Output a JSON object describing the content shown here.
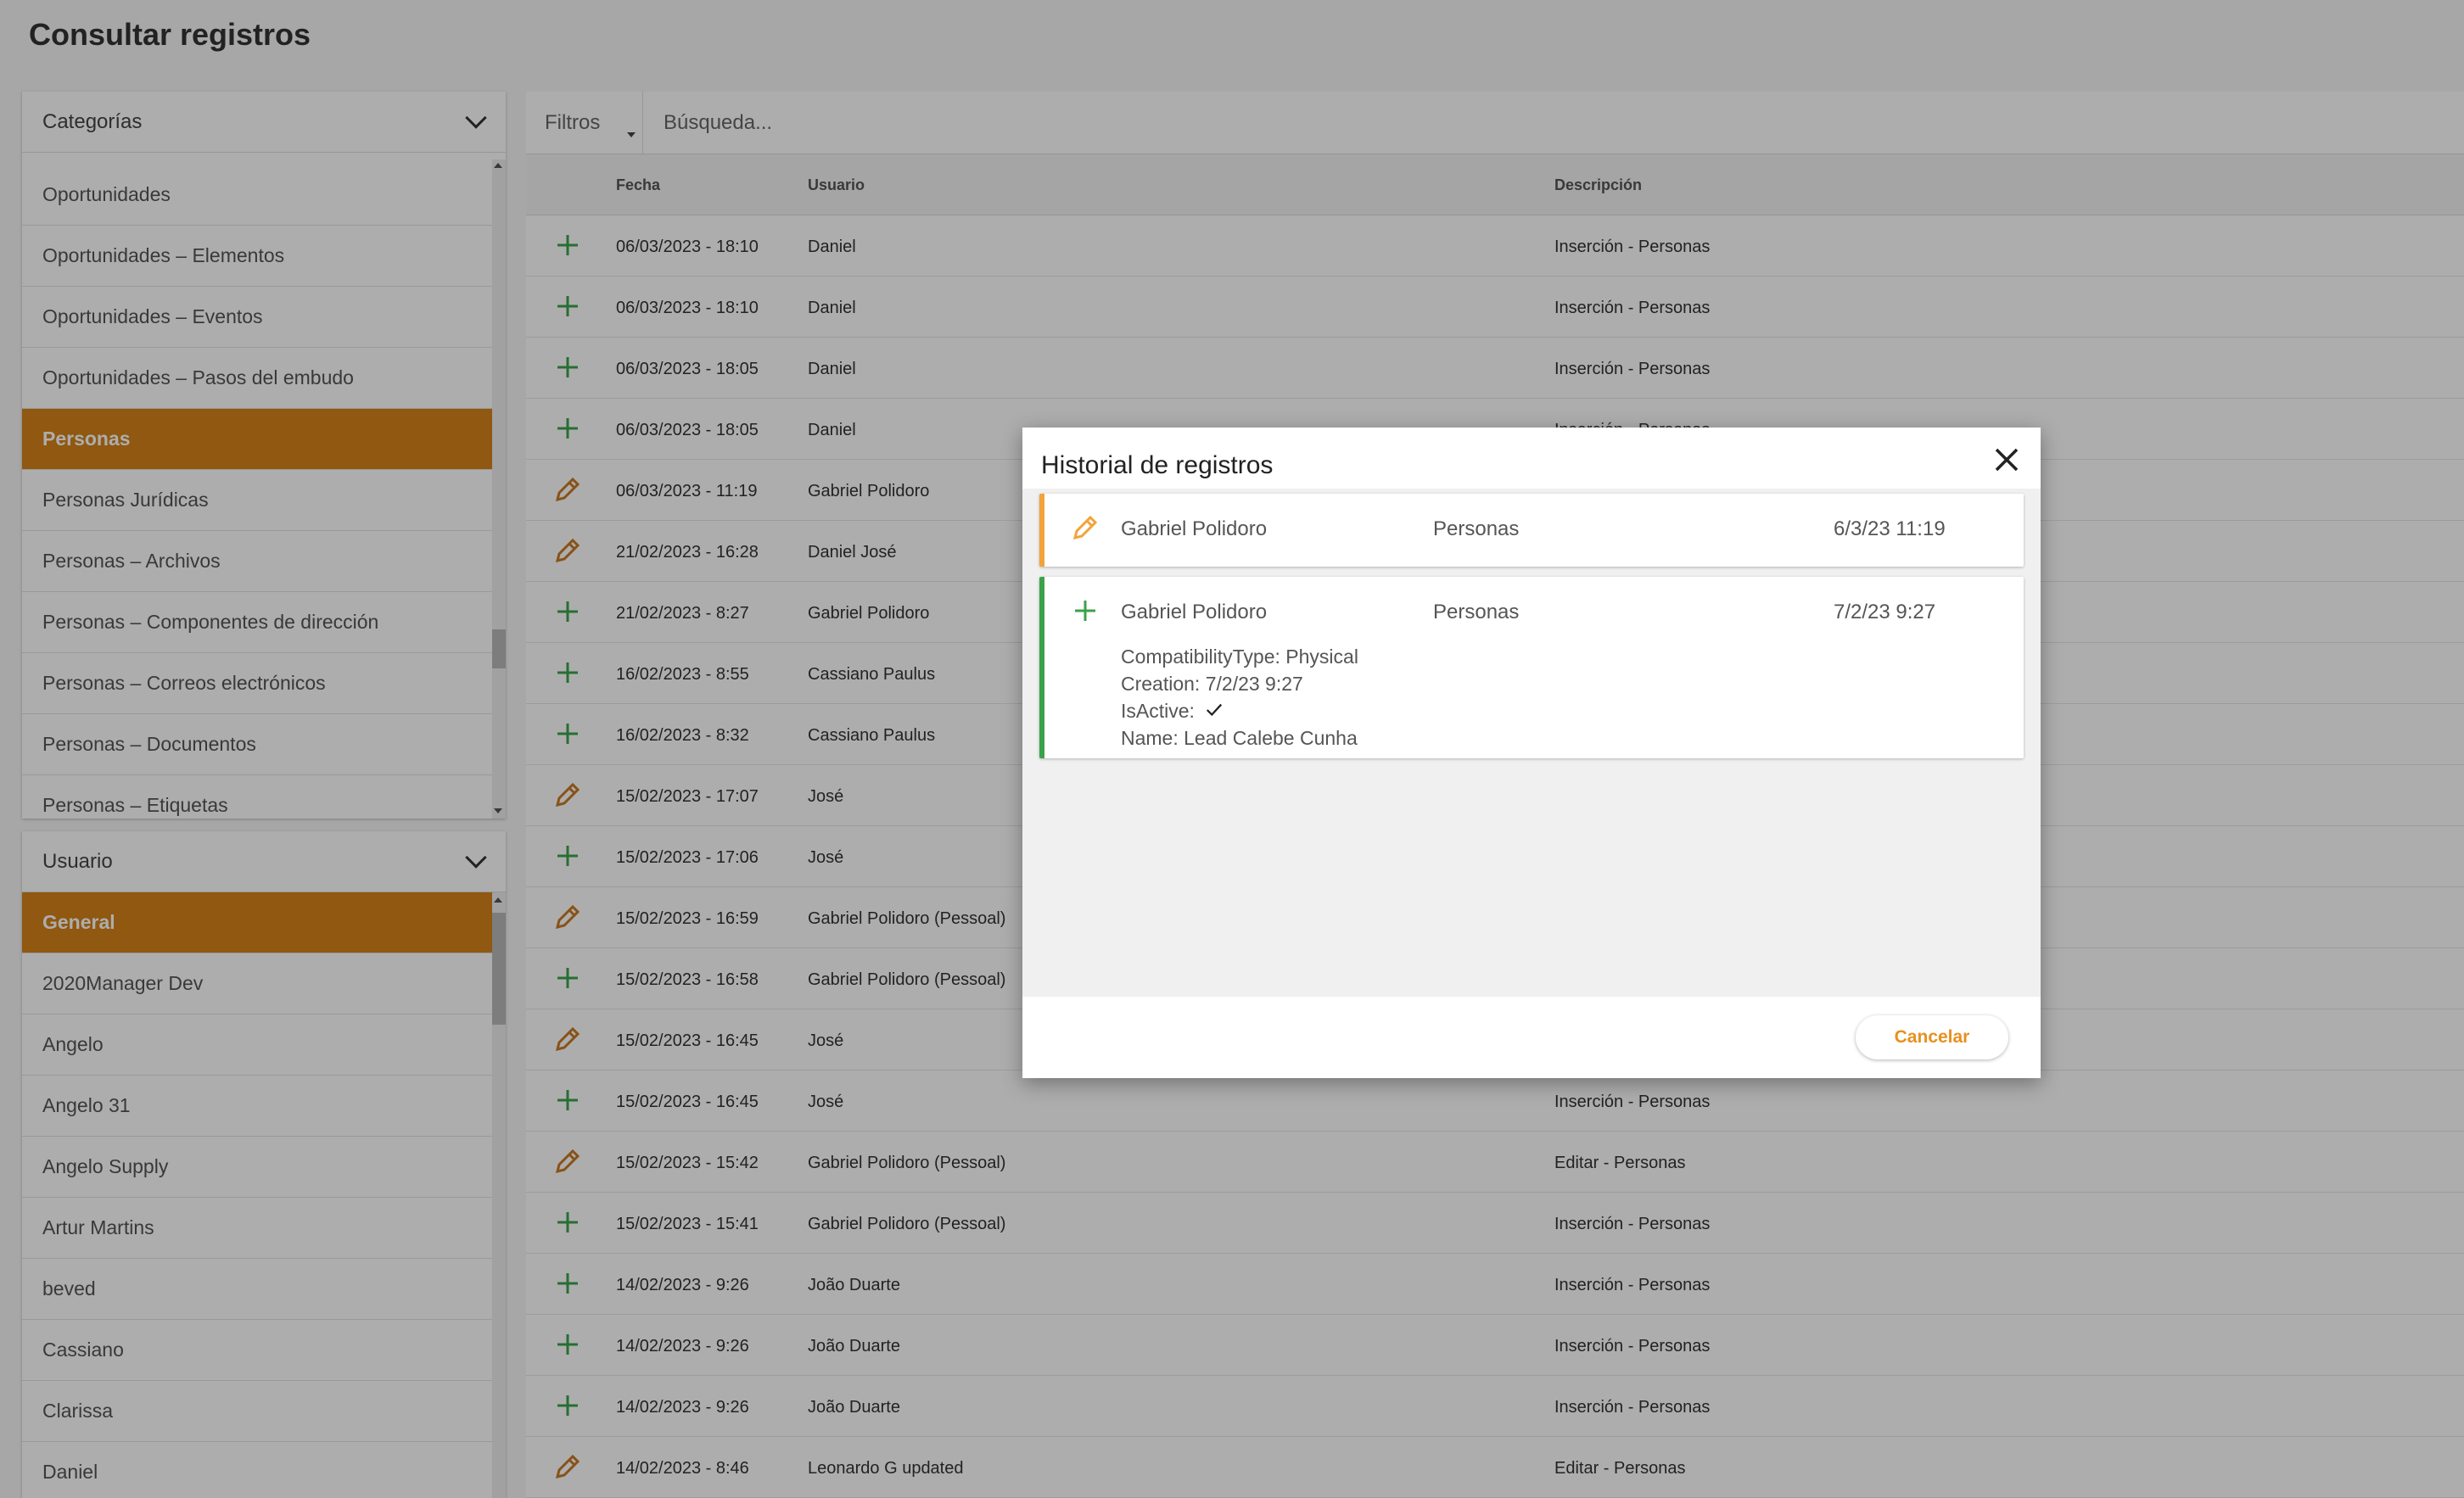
{
  "page": {
    "title": "Consultar registros"
  },
  "colors": {
    "accent": "#d48219",
    "insert": "#3aa24a",
    "edit": "#c97a24",
    "edit_modal": "#f2a33a"
  },
  "categories": {
    "header": "Categorías",
    "items": [
      {
        "label": "Oportunidades",
        "active": false
      },
      {
        "label": "Oportunidades – Elementos",
        "active": false
      },
      {
        "label": "Oportunidades – Eventos",
        "active": false
      },
      {
        "label": "Oportunidades – Pasos del embudo",
        "active": false
      },
      {
        "label": "Personas",
        "active": true
      },
      {
        "label": "Personas Jurídicas",
        "active": false
      },
      {
        "label": "Personas – Archivos",
        "active": false
      },
      {
        "label": "Personas – Componentes de dirección",
        "active": false
      },
      {
        "label": "Personas – Correos electrónicos",
        "active": false
      },
      {
        "label": "Personas – Documentos",
        "active": false
      },
      {
        "label": "Personas – Etiquetas",
        "active": false
      }
    ]
  },
  "users": {
    "header": "Usuario",
    "items": [
      {
        "label": "General",
        "active": true
      },
      {
        "label": "2020Manager Dev",
        "active": false
      },
      {
        "label": "Angelo",
        "active": false
      },
      {
        "label": "Angelo 31",
        "active": false
      },
      {
        "label": "Angelo Supply",
        "active": false
      },
      {
        "label": "Artur Martins",
        "active": false
      },
      {
        "label": "beved",
        "active": false
      },
      {
        "label": "Cassiano",
        "active": false
      },
      {
        "label": "Clarissa",
        "active": false
      },
      {
        "label": "Daniel",
        "active": false
      }
    ]
  },
  "toolbar": {
    "filters_label": "Filtros",
    "search_placeholder": "Búsqueda..."
  },
  "table": {
    "headers": {
      "fecha": "Fecha",
      "usuario": "Usuario",
      "descripcion": "Descripción"
    },
    "rows": [
      {
        "type": "insert",
        "fecha": "06/03/2023 - 18:10",
        "usuario": "Daniel",
        "descripcion": "Inserción - Personas"
      },
      {
        "type": "insert",
        "fecha": "06/03/2023 - 18:10",
        "usuario": "Daniel",
        "descripcion": "Inserción - Personas"
      },
      {
        "type": "insert",
        "fecha": "06/03/2023 - 18:05",
        "usuario": "Daniel",
        "descripcion": "Inserción - Personas"
      },
      {
        "type": "insert",
        "fecha": "06/03/2023 - 18:05",
        "usuario": "Daniel",
        "descripcion": "Inserción - Personas"
      },
      {
        "type": "edit",
        "fecha": "06/03/2023 - 11:19",
        "usuario": "Gabriel Polidoro",
        "descripcion": ""
      },
      {
        "type": "edit",
        "fecha": "21/02/2023 - 16:28",
        "usuario": "Daniel José",
        "descripcion": ""
      },
      {
        "type": "insert",
        "fecha": "21/02/2023 - 8:27",
        "usuario": "Gabriel Polidoro",
        "descripcion": ""
      },
      {
        "type": "insert",
        "fecha": "16/02/2023 - 8:55",
        "usuario": "Cassiano Paulus",
        "descripcion": ""
      },
      {
        "type": "insert",
        "fecha": "16/02/2023 - 8:32",
        "usuario": "Cassiano Paulus",
        "descripcion": ""
      },
      {
        "type": "edit",
        "fecha": "15/02/2023 - 17:07",
        "usuario": "José",
        "descripcion": ""
      },
      {
        "type": "insert",
        "fecha": "15/02/2023 - 17:06",
        "usuario": "José",
        "descripcion": ""
      },
      {
        "type": "edit",
        "fecha": "15/02/2023 - 16:59",
        "usuario": "Gabriel Polidoro (Pessoal)",
        "descripcion": ""
      },
      {
        "type": "insert",
        "fecha": "15/02/2023 - 16:58",
        "usuario": "Gabriel Polidoro (Pessoal)",
        "descripcion": ""
      },
      {
        "type": "edit",
        "fecha": "15/02/2023 - 16:45",
        "usuario": "José",
        "descripcion": ""
      },
      {
        "type": "insert",
        "fecha": "15/02/2023 - 16:45",
        "usuario": "José",
        "descripcion": "Inserción - Personas"
      },
      {
        "type": "edit",
        "fecha": "15/02/2023 - 15:42",
        "usuario": "Gabriel Polidoro (Pessoal)",
        "descripcion": "Editar - Personas"
      },
      {
        "type": "insert",
        "fecha": "15/02/2023 - 15:41",
        "usuario": "Gabriel Polidoro (Pessoal)",
        "descripcion": "Inserción - Personas"
      },
      {
        "type": "insert",
        "fecha": "14/02/2023 - 9:26",
        "usuario": "João Duarte",
        "descripcion": "Inserción - Personas"
      },
      {
        "type": "insert",
        "fecha": "14/02/2023 - 9:26",
        "usuario": "João Duarte",
        "descripcion": "Inserción - Personas"
      },
      {
        "type": "insert",
        "fecha": "14/02/2023 - 9:26",
        "usuario": "João Duarte",
        "descripcion": "Inserción - Personas"
      },
      {
        "type": "edit",
        "fecha": "14/02/2023 - 8:46",
        "usuario": "Leonardo G updated",
        "descripcion": "Editar - Personas"
      }
    ]
  },
  "modal": {
    "title": "Historial de registros",
    "cancel_label": "Cancelar",
    "entries": [
      {
        "type": "edit",
        "user": "Gabriel Polidoro",
        "entity": "Personas",
        "datetime": "6/3/23 11:19",
        "details": []
      },
      {
        "type": "insert",
        "user": "Gabriel Polidoro",
        "entity": "Personas",
        "datetime": "7/2/23 9:27",
        "details": [
          {
            "text": "CompatibilityType: Physical",
            "check": false
          },
          {
            "text": "Creation: 7/2/23 9:27",
            "check": false
          },
          {
            "text": "IsActive:",
            "check": true
          },
          {
            "text": "Name: Lead Calebe Cunha",
            "check": false
          }
        ]
      }
    ]
  }
}
